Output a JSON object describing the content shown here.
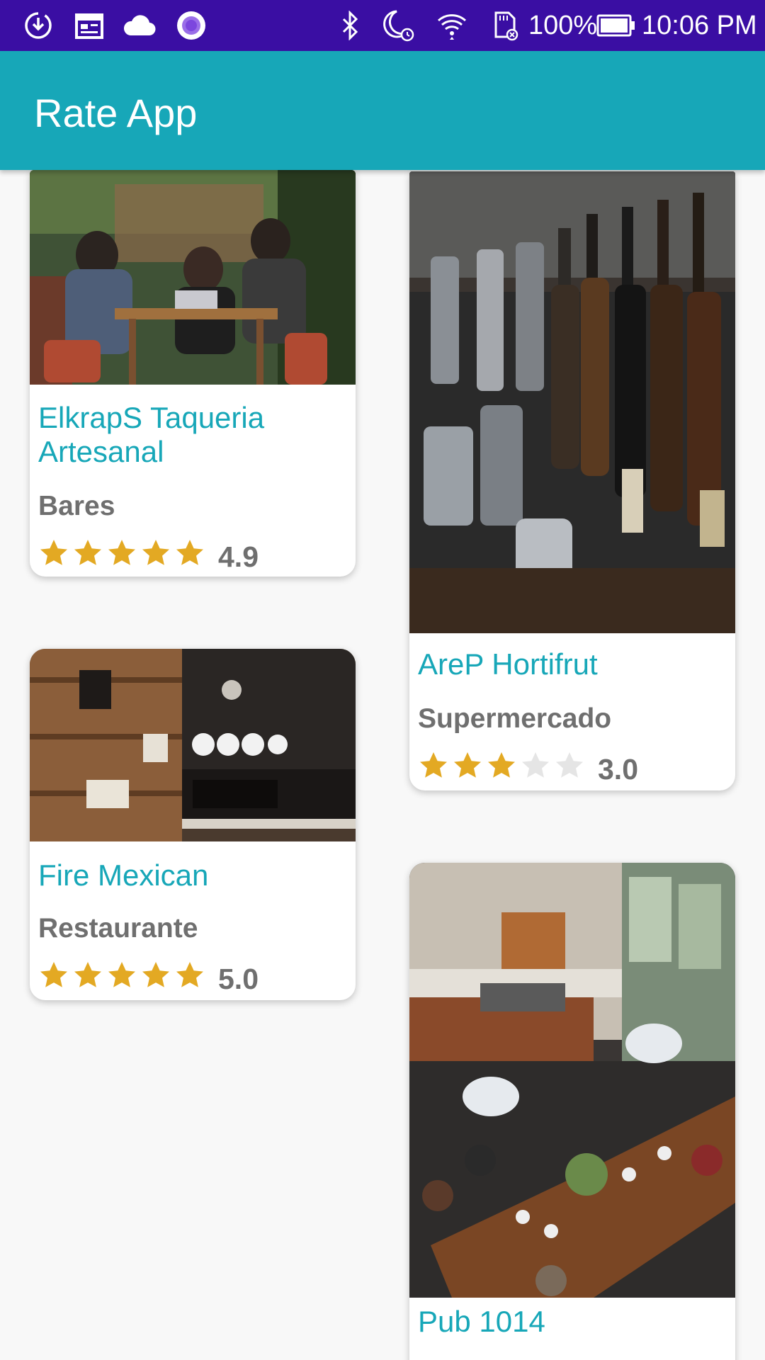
{
  "status_bar": {
    "battery": "100%",
    "time": "10:06 PM",
    "icons": [
      "download-sync-icon",
      "calendar-icon",
      "cloud-icon",
      "circle-record-icon",
      "bluetooth-icon",
      "do-not-disturb-alarm-icon",
      "wifi-icon",
      "sd-card-icon",
      "battery-icon"
    ]
  },
  "app_bar": {
    "title": "Rate App"
  },
  "colors": {
    "status_bar": "#3a0ea3",
    "app_bar": "#17a7b8",
    "accent_text": "#17a7b8",
    "star_filled": "#e3a923",
    "star_empty": "#e5e5e5"
  },
  "places": [
    {
      "name": "ElkrapS Taqueria Artesanal",
      "category": "Bares",
      "rating": "4.9",
      "stars": 5,
      "image": "people-working-at-table-photo"
    },
    {
      "name": "AreP Hortifrut",
      "category": "Supermercado",
      "rating": "3.0",
      "stars": 3,
      "image": "bar-bottles-photo"
    },
    {
      "name": "Fire Mexican",
      "category": "Restaurante",
      "rating": "5.0",
      "stars": 5,
      "image": "coffee-shop-wall-photo"
    },
    {
      "name": "Pub 1014",
      "category": "",
      "rating": "",
      "stars": 0,
      "image": "restaurant-overhead-photo"
    }
  ]
}
